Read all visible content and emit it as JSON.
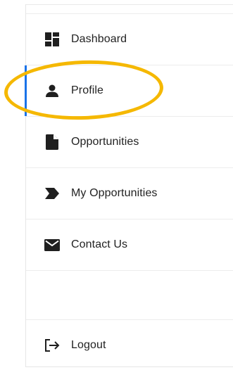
{
  "nav": {
    "items": [
      {
        "label": "Dashboard",
        "icon": "dashboard-icon"
      },
      {
        "label": "Profile",
        "icon": "person-icon",
        "active": true
      },
      {
        "label": "Opportunities",
        "icon": "document-icon"
      },
      {
        "label": "My Opportunities",
        "icon": "chevron-tag-icon"
      },
      {
        "label": "Contact Us",
        "icon": "envelope-icon"
      }
    ],
    "logout_label": "Logout",
    "logout_icon": "logout-icon"
  },
  "colors": {
    "active_indicator": "#1a73e8",
    "highlight_ring": "#f5b800",
    "icon": "#1f1f1f"
  }
}
